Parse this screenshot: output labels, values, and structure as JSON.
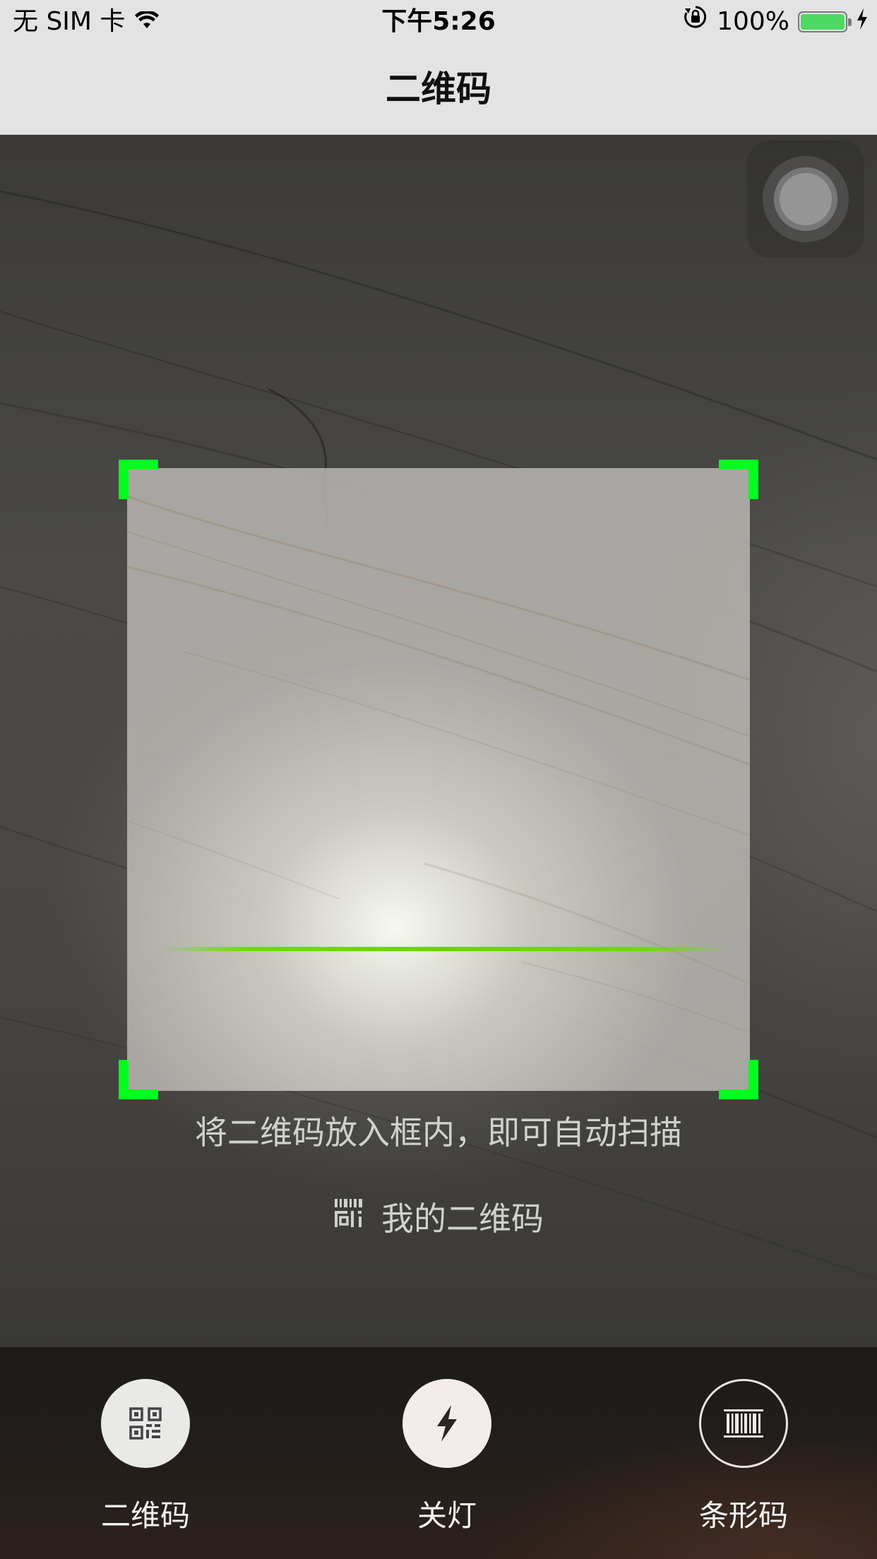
{
  "status_bar": {
    "carrier": "无 SIM 卡",
    "time": "下午5:26",
    "battery_percent": "100%",
    "battery_level": 1.0,
    "icons": [
      "wifi-icon",
      "orientation-lock-icon",
      "battery-icon",
      "charging-icon"
    ]
  },
  "nav": {
    "title": "二维码"
  },
  "scanner": {
    "hint": "将二维码放入框内，即可自动扫描",
    "my_qr_label": "我的二维码",
    "frame_color": "#00ff1e",
    "scan_line_color": "#6ad400"
  },
  "toolbar": {
    "items": [
      {
        "label": "二维码",
        "icon": "qr-code-icon"
      },
      {
        "label": "关灯",
        "icon": "flash-icon"
      },
      {
        "label": "条形码",
        "icon": "barcode-icon"
      }
    ]
  }
}
